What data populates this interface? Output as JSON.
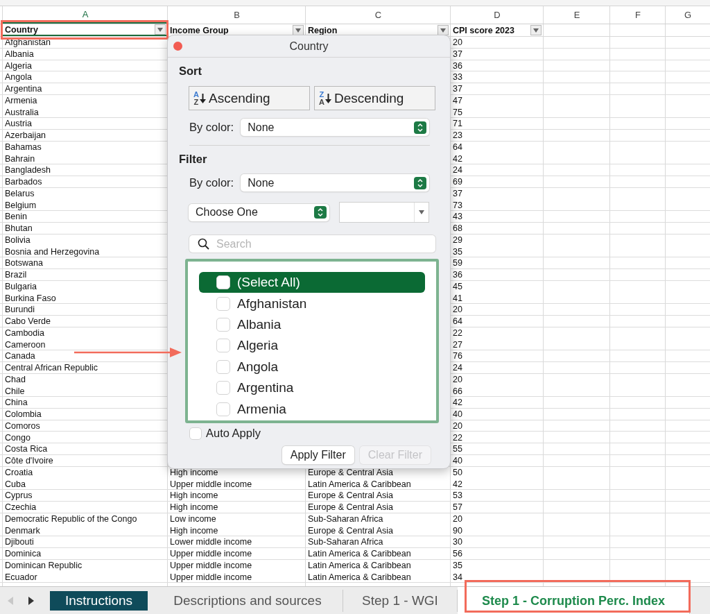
{
  "columns": [
    {
      "letter": "A",
      "selected": true
    },
    {
      "letter": "B",
      "selected": false
    },
    {
      "letter": "C",
      "selected": false
    },
    {
      "letter": "D",
      "selected": false
    },
    {
      "letter": "E",
      "selected": false
    },
    {
      "letter": "F",
      "selected": false
    },
    {
      "letter": "G",
      "selected": false
    }
  ],
  "header_cells": [
    "Country",
    "Income Group",
    "Region",
    "CPI score 2023"
  ],
  "rows": [
    {
      "country": "Afghanistan",
      "score": "20"
    },
    {
      "country": "Albania",
      "score": "37"
    },
    {
      "country": "Algeria",
      "score": "36"
    },
    {
      "country": "Angola",
      "score": "33"
    },
    {
      "country": "Argentina",
      "score": "37"
    },
    {
      "country": "Armenia",
      "score": "47"
    },
    {
      "country": "Australia",
      "score": "75"
    },
    {
      "country": "Austria",
      "score": "71"
    },
    {
      "country": "Azerbaijan",
      "score": "23"
    },
    {
      "country": "Bahamas",
      "score": "64"
    },
    {
      "country": "Bahrain",
      "score": "42"
    },
    {
      "country": "Bangladesh",
      "score": "24"
    },
    {
      "country": "Barbados",
      "score": "69"
    },
    {
      "country": "Belarus",
      "score": "37"
    },
    {
      "country": "Belgium",
      "score": "73"
    },
    {
      "country": "Benin",
      "score": "43"
    },
    {
      "country": "Bhutan",
      "score": "68"
    },
    {
      "country": "Bolivia",
      "score": "29"
    },
    {
      "country": "Bosnia and Herzegovina",
      "score": "35"
    },
    {
      "country": "Botswana",
      "score": "59"
    },
    {
      "country": "Brazil",
      "score": "36"
    },
    {
      "country": "Bulgaria",
      "score": "45"
    },
    {
      "country": "Burkina Faso",
      "score": "41"
    },
    {
      "country": "Burundi",
      "score": "20"
    },
    {
      "country": "Cabo Verde",
      "score": "64"
    },
    {
      "country": "Cambodia",
      "score": "22"
    },
    {
      "country": "Cameroon",
      "score": "27"
    },
    {
      "country": "Canada",
      "score": "76"
    },
    {
      "country": "Central African Republic",
      "score": "24"
    },
    {
      "country": "Chad",
      "score": "20"
    },
    {
      "country": "Chile",
      "score": "66"
    },
    {
      "country": "China",
      "score": "42"
    },
    {
      "country": "Colombia",
      "score": "40"
    },
    {
      "country": "Comoros",
      "score": "20"
    },
    {
      "country": "Congo",
      "score": "22"
    },
    {
      "country": "Costa Rica",
      "score": "55"
    },
    {
      "country": "Côte d'Ivoire",
      "score": "40"
    },
    {
      "country": "Croatia",
      "income": "High income",
      "region": "Europe & Central Asia",
      "score": "50"
    },
    {
      "country": "Cuba",
      "income": "Upper middle income",
      "region": "Latin America & Caribbean",
      "score": "42"
    },
    {
      "country": "Cyprus",
      "income": "High income",
      "region": "Europe & Central Asia",
      "score": "53"
    },
    {
      "country": "Czechia",
      "income": "High income",
      "region": "Europe & Central Asia",
      "score": "57"
    },
    {
      "country": "Democratic Republic of the Congo",
      "income": "Low income",
      "region": "Sub-Saharan Africa",
      "score": "20"
    },
    {
      "country": "Denmark",
      "income": "High income",
      "region": "Europe & Central Asia",
      "score": "90"
    },
    {
      "country": "Djibouti",
      "income": "Lower middle income",
      "region": "Sub-Saharan Africa",
      "score": "30"
    },
    {
      "country": "Dominica",
      "income": "Upper middle income",
      "region": "Latin America & Caribbean",
      "score": "56"
    },
    {
      "country": "Dominican Republic",
      "income": "Upper middle income",
      "region": "Latin America & Caribbean",
      "score": "35"
    },
    {
      "country": "Ecuador",
      "income": "Upper middle income",
      "region": "Latin America & Caribbean",
      "score": "34"
    }
  ],
  "filter_popup": {
    "title": "Country",
    "sort": {
      "heading": "Sort",
      "buttons": [
        {
          "label": "Ascending",
          "icon_top": "A",
          "icon_bottom": "Z"
        },
        {
          "label": "Descending",
          "icon_top": "Z",
          "icon_bottom": "A"
        }
      ],
      "by_color_label": "By color:",
      "by_color_value": "None"
    },
    "filter": {
      "heading": "Filter",
      "by_color_label": "By color:",
      "by_color_value": "None",
      "condition": "Choose One",
      "search_placeholder": "Search",
      "items": [
        {
          "label": "(Select All)",
          "checked": false,
          "selected": true
        },
        {
          "label": "Afghanistan",
          "checked": false,
          "selected": false
        },
        {
          "label": "Albania",
          "checked": false,
          "selected": false
        },
        {
          "label": "Algeria",
          "checked": false,
          "selected": false
        },
        {
          "label": "Angola",
          "checked": false,
          "selected": false
        },
        {
          "label": "Argentina",
          "checked": false,
          "selected": false
        },
        {
          "label": "Armenia",
          "checked": false,
          "selected": false
        }
      ],
      "auto_apply": {
        "label": "Auto Apply",
        "checked": false
      },
      "apply_button": {
        "label": "Apply Filter",
        "disabled": false
      },
      "clear_button": {
        "label": "Clear Filter",
        "disabled": true
      }
    }
  },
  "sheet_tabs": [
    {
      "label": "Instructions",
      "selected": false,
      "color": "#0f4b5a"
    },
    {
      "label": "Descriptions and sources",
      "selected": false
    },
    {
      "label": "Step 1 - WGI",
      "selected": false
    },
    {
      "label": "Step 1 - Corruption Perc. Index",
      "selected": true
    }
  ]
}
